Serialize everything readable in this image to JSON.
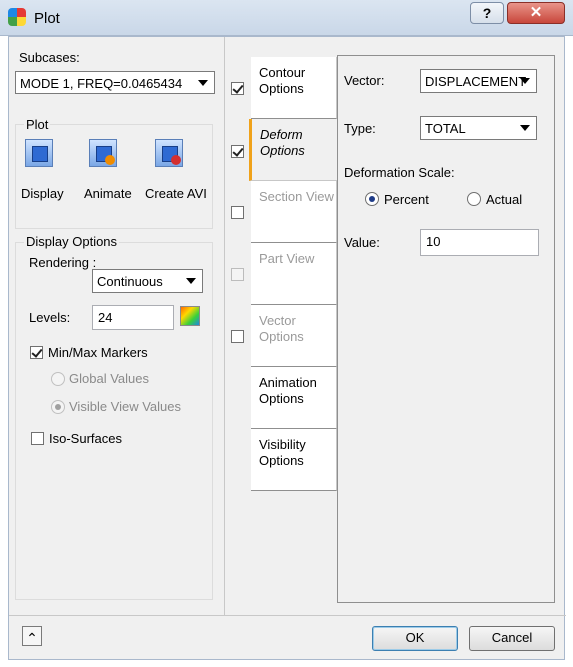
{
  "window": {
    "title": "Plot",
    "help_label": "?",
    "close_label": "✕"
  },
  "subcases": {
    "label": "Subcases:",
    "value": "MODE 1, FREQ=0.0465434"
  },
  "plot": {
    "label": "Plot",
    "tools": [
      {
        "label": "Display",
        "icon": "display-icon"
      },
      {
        "label": "Animate",
        "icon": "animate-icon"
      },
      {
        "label": "Create AVI",
        "icon": "create-avi-icon"
      }
    ]
  },
  "display_options": {
    "label": "Display Options",
    "rendering_label": "Rendering :",
    "rendering_value": "Continuous",
    "levels_label": "Levels:",
    "levels_value": "24",
    "minmax_label": "Min/Max Markers",
    "minmax_checked": true,
    "global_values_label": "Global Values",
    "visible_view_values_label": "Visible View Values",
    "iso_surfaces_label": "Iso-Surfaces",
    "iso_surfaces_checked": false
  },
  "tabs": [
    {
      "line1": "Contour",
      "line2": "Options",
      "checked": true,
      "has_checkbox": true,
      "enabled": true,
      "active": false
    },
    {
      "line1": "Deform",
      "line2": "Options",
      "checked": true,
      "has_checkbox": true,
      "enabled": true,
      "active": true
    },
    {
      "line1": "Section View",
      "line2": "",
      "checked": false,
      "has_checkbox": true,
      "enabled": false,
      "active": false
    },
    {
      "line1": "Part View",
      "line2": "",
      "checked": false,
      "has_checkbox": true,
      "enabled": false,
      "active": false
    },
    {
      "line1": "Vector",
      "line2": "Options",
      "checked": false,
      "has_checkbox": true,
      "enabled": false,
      "active": false
    },
    {
      "line1": "Animation",
      "line2": "Options",
      "has_checkbox": false,
      "enabled": true,
      "active": false
    },
    {
      "line1": "Visibility",
      "line2": "Options",
      "has_checkbox": false,
      "enabled": true,
      "active": false
    }
  ],
  "deform": {
    "vector_label": "Vector:",
    "vector_value": "DISPLACEMENT",
    "type_label": "Type:",
    "type_value": "TOTAL",
    "scale_label": "Deformation Scale:",
    "percent_label": "Percent",
    "actual_label": "Actual",
    "scale_mode": "Percent",
    "value_label": "Value:",
    "value": "10"
  },
  "footer": {
    "expand_label": "⌃",
    "ok_label": "OK",
    "cancel_label": "Cancel"
  }
}
